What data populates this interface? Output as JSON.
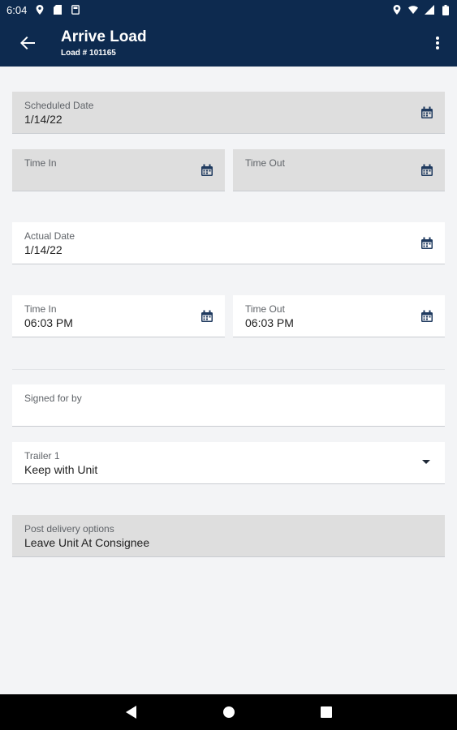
{
  "status_bar": {
    "time": "6:04",
    "icons": [
      "location-icon",
      "sim-card-icon",
      "storage-icon",
      "location-icon",
      "wifi-icon",
      "signal-icon",
      "battery-icon"
    ]
  },
  "app_bar": {
    "title": "Arrive Load",
    "subtitle": "Load # 101165",
    "back_icon": "arrow-back-icon",
    "menu_icon": "more-vert-icon"
  },
  "form": {
    "scheduled_date": {
      "label": "Scheduled Date",
      "value": "1/14/22",
      "disabled": true,
      "icon": "calendar-icon"
    },
    "scheduled_time_in": {
      "label": "Time In",
      "value": "",
      "disabled": true,
      "icon": "calendar-icon"
    },
    "scheduled_time_out": {
      "label": "Time Out",
      "value": "",
      "disabled": true,
      "icon": "calendar-icon"
    },
    "actual_date": {
      "label": "Actual Date",
      "value": "1/14/22",
      "disabled": false,
      "icon": "calendar-icon"
    },
    "actual_time_in": {
      "label": "Time In",
      "value": "06:03 PM",
      "disabled": false,
      "icon": "calendar-icon"
    },
    "actual_time_out": {
      "label": "Time Out",
      "value": "06:03 PM",
      "disabled": false,
      "icon": "calendar-icon"
    },
    "signed_for_by": {
      "label": "Signed for by",
      "value": "",
      "disabled": false
    },
    "trailer": {
      "label": "Trailer 1",
      "value": "Keep with Unit",
      "disabled": false,
      "icon": "dropdown-arrow-icon"
    },
    "post_delivery": {
      "label": "Post delivery options",
      "value": "Leave Unit At Consignee",
      "disabled": true
    }
  },
  "nav_bar": {
    "icons": [
      "back-triangle-icon",
      "home-circle-icon",
      "recents-square-icon"
    ]
  },
  "colors": {
    "header_bg": "#0d2a4f",
    "page_bg": "#f3f4f6",
    "disabled_field_bg": "#dedede",
    "enabled_field_bg": "#ffffff",
    "icon_color": "#1f3a5f"
  }
}
